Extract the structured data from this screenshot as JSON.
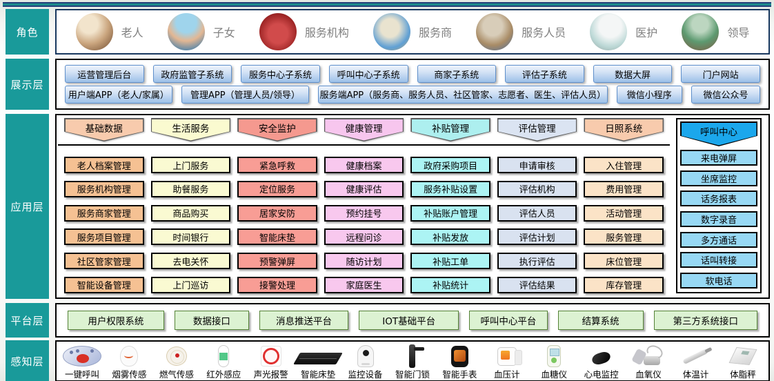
{
  "colors": {
    "layer_label_teal": "#199A9A",
    "top_bar_teal": "#1D8C8C",
    "roles_border_navy": "#17375E",
    "display_button_blue": "#9CC0E8",
    "display_button_border": "#5E8FCB",
    "platform_green_fill": "#DCF2D2",
    "platform_green_border": "#538135",
    "call_center_blue": "#1BA7EC"
  },
  "roles": {
    "label": "角色",
    "items": [
      {
        "label": "老人",
        "icon": "elderly-photo"
      },
      {
        "label": "子女",
        "icon": "children-photo"
      },
      {
        "label": "服务机构",
        "icon": "service-org-photo"
      },
      {
        "label": "服务商",
        "icon": "service-provider-photo"
      },
      {
        "label": "服务人员",
        "icon": "service-staff-photo"
      },
      {
        "label": "医护",
        "icon": "medical-photo"
      },
      {
        "label": "领导",
        "icon": "leader-photo"
      }
    ]
  },
  "display_layer": {
    "label": "展示层",
    "row1": [
      "运营管理后台",
      "政府监管子系统",
      "服务中心子系统",
      "呼叫中心子系统",
      "商家子系统",
      "评估子系统",
      "数据大屏",
      "门户网站"
    ],
    "row2": [
      "用户端APP（老人/家属）",
      "管理APP（管理人员/领导）",
      "服务端APP（服务商、服务人员、社区管家、志愿者、医生、评估人员）",
      "微信小程序",
      "微信公众号"
    ]
  },
  "app_layer": {
    "label": "应用层",
    "columns": [
      {
        "header": "基础数据",
        "header_color": "#F8CBAD",
        "item_color": "#F5C193",
        "items": [
          "老人档案管理",
          "服务机构管理",
          "服务商家管理",
          "服务项目管理",
          "社区管家管理",
          "智能设备管理"
        ]
      },
      {
        "header": "生活服务",
        "header_color": "#FAFAD0",
        "item_color": "#FAFAD2",
        "items": [
          "上门服务",
          "助餐服务",
          "商品购买",
          "时间银行",
          "去电关怀",
          "上门巡访"
        ]
      },
      {
        "header": "安全监护",
        "header_color": "#F5998F",
        "item_color": "#F89D95",
        "items": [
          "紧急呼救",
          "定位服务",
          "居家安防",
          "智能床垫",
          "预警弹屏",
          "接警处理"
        ]
      },
      {
        "header": "健康管理",
        "header_color": "#F7C6EE",
        "item_color": "#F8C8EE",
        "items": [
          "健康档案",
          "健康评估",
          "预约挂号",
          "远程问诊",
          "随访计划",
          "家庭医生"
        ]
      },
      {
        "header": "补贴管理",
        "header_color": "#ADEFEF",
        "item_color": "#ACF4F4",
        "items": [
          "政府采购项目",
          "服务补贴设置",
          "补贴账户管理",
          "补贴发放",
          "补贴工单",
          "补贴统计"
        ]
      },
      {
        "header": "评估管理",
        "header_color": "#DBE4F2",
        "item_color": "#D9E2F0",
        "items": [
          "申请审核",
          "评估机构",
          "评估人员",
          "评估计划",
          "执行评估",
          "评估结果"
        ]
      },
      {
        "header": "日照系统",
        "header_color": "#F8CBAD",
        "item_color": "#FBE3C7",
        "items": [
          "入住管理",
          "费用管理",
          "活动管理",
          "服务管理",
          "床位管理",
          "库存管理"
        ]
      },
      {
        "header": "呼叫中心",
        "header_color": "#1BA7EC",
        "item_color": "#97D8F4",
        "items": [
          "来电弹屏",
          "坐席监控",
          "话务报表",
          "数字录音",
          "多方通话",
          "话叫转接",
          "软电话"
        ]
      }
    ]
  },
  "platform_layer": {
    "label": "平台层",
    "items": [
      "用户权限系统",
      "数据接口",
      "消息推送平台",
      "IOT基础平台",
      "呼叫中心平台",
      "结算系统",
      "第三方系统接口"
    ]
  },
  "perception_layer": {
    "label": "感知层",
    "devices": [
      {
        "label": "一键呼叫",
        "icon": "call-button-icon"
      },
      {
        "label": "烟雾传感",
        "icon": "smoke-sensor-icon"
      },
      {
        "label": "燃气传感",
        "icon": "gas-sensor-icon"
      },
      {
        "label": "红外感应",
        "icon": "infrared-sensor-icon"
      },
      {
        "label": "声光报警",
        "icon": "sound-light-alarm-icon"
      },
      {
        "label": "智能床垫",
        "icon": "smart-mattress-icon"
      },
      {
        "label": "监控设备",
        "icon": "camera-icon"
      },
      {
        "label": "智能门锁",
        "icon": "door-lock-icon"
      },
      {
        "label": "智能手表",
        "icon": "smart-watch-icon"
      },
      {
        "label": "血压计",
        "icon": "blood-pressure-icon"
      },
      {
        "label": "血糖仪",
        "icon": "glucose-meter-icon"
      },
      {
        "label": "心电监控",
        "icon": "ecg-monitor-icon"
      },
      {
        "label": "血氧仪",
        "icon": "oximeter-icon"
      },
      {
        "label": "体温计",
        "icon": "thermometer-icon"
      },
      {
        "label": "体脂秤",
        "icon": "body-scale-icon"
      }
    ]
  }
}
